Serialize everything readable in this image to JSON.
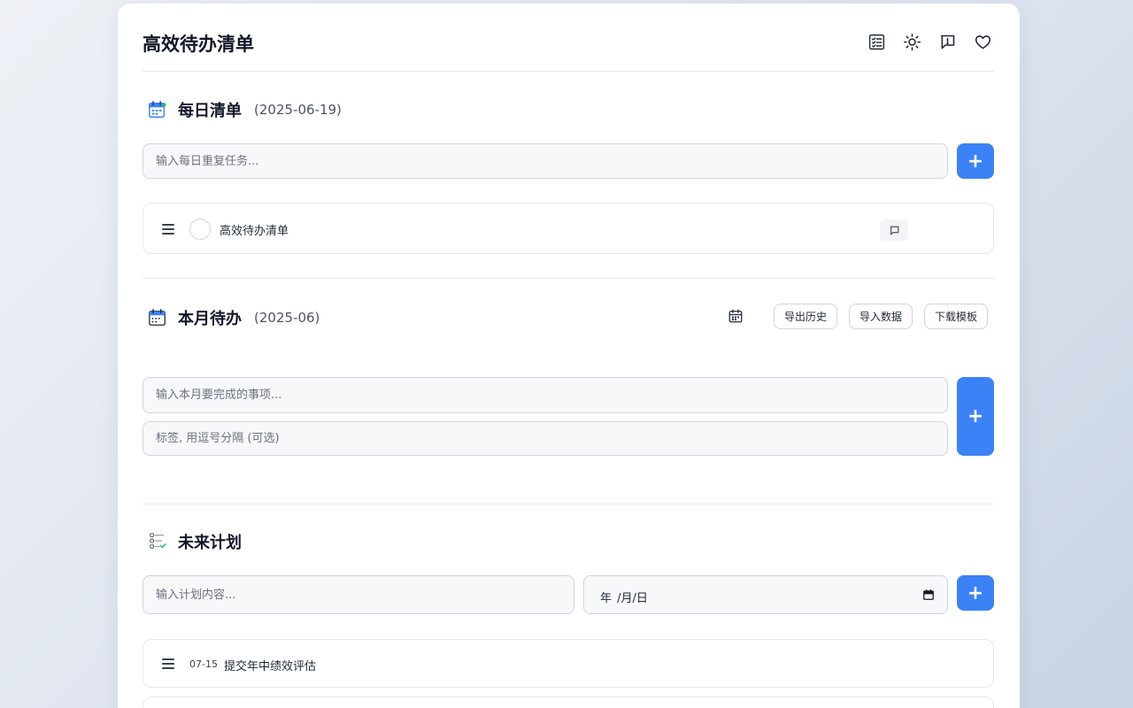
{
  "app": {
    "title": "高效待办清单"
  },
  "header_icons": [
    "checklist-icon",
    "sun-icon",
    "feedback-icon",
    "heart-icon"
  ],
  "daily": {
    "title": "每日清单",
    "date": "(2025-06-19)",
    "input_placeholder": "输入每日重复任务...",
    "add_label": "+",
    "items": [
      {
        "text": "高效待办清单"
      }
    ]
  },
  "monthly": {
    "title": "本月待办",
    "date": "(2025-06)",
    "export_label": "导出历史",
    "import_label": "导入数据",
    "template_label": "下载模板",
    "input_placeholder": "输入本月要完成的事项...",
    "tags_placeholder": "标签, 用逗号分隔 (可选)",
    "add_label": "+"
  },
  "future": {
    "title": "未来计划",
    "input_placeholder": "输入计划内容...",
    "date_placeholder": "年 /月/日",
    "add_label": "+",
    "items": [
      {
        "date": "07-15",
        "text": "提交年中绩效评估"
      }
    ]
  },
  "colors": {
    "accent": "#3b82f6",
    "border": "#e5e7eb",
    "input_bg": "#f7f8fa"
  }
}
